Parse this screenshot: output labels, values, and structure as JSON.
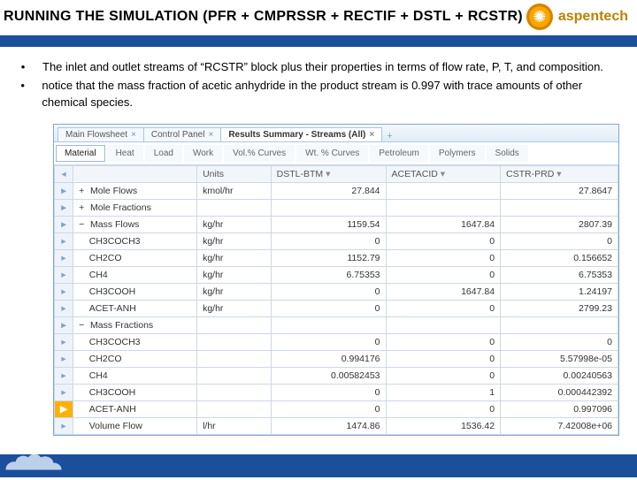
{
  "header": {
    "title": "RUNNING THE SIMULATION (PFR + CMPRSSR + RECTIF + DSTL + RCSTR)",
    "brand": "aspentech"
  },
  "bullets": [
    "The inlet and outlet streams of “RCSTR” block plus their properties in terms of flow rate, P, T, and composition.",
    "notice that the mass fraction of acetic anhydride in the product stream is 0.997 with trace amounts of other chemical species."
  ],
  "window": {
    "tabs": [
      "Main Flowsheet",
      "Control Panel",
      "Results Summary - Streams (All)"
    ],
    "activeTab": 2,
    "subTabs": [
      "Material",
      "Heat",
      "Load",
      "Work",
      "Vol.% Curves",
      "Wt. % Curves",
      "Petroleum",
      "Polymers",
      "Solids"
    ]
  },
  "grid": {
    "unitsHeader": "Units",
    "streams": [
      "DSTL-BTM",
      "ACETACID",
      "CSTR-PRD"
    ],
    "rows": [
      {
        "section": true,
        "exp": "+",
        "label": "Mole Flows",
        "units": "kmol/hr",
        "v": [
          "27.844",
          "",
          "27.8647"
        ]
      },
      {
        "section": true,
        "exp": "+",
        "label": "Mole Fractions",
        "units": "",
        "v": [
          "",
          "",
          ""
        ]
      },
      {
        "section": true,
        "exp": "−",
        "label": "Mass Flows",
        "units": "kg/hr",
        "v": [
          "1159.54",
          "1647.84",
          "2807.39"
        ]
      },
      {
        "label": "CH3COCH3",
        "units": "kg/hr",
        "v": [
          "0",
          "0",
          "0"
        ]
      },
      {
        "label": "CH2CO",
        "units": "kg/hr",
        "v": [
          "1152.79",
          "0",
          "0.156652"
        ]
      },
      {
        "label": "CH4",
        "units": "kg/hr",
        "v": [
          "6.75353",
          "0",
          "6.75353"
        ]
      },
      {
        "label": "CH3COOH",
        "units": "kg/hr",
        "v": [
          "0",
          "1647.84",
          "1.24197"
        ]
      },
      {
        "label": "ACET-ANH",
        "units": "kg/hr",
        "v": [
          "0",
          "0",
          "2799.23"
        ]
      },
      {
        "section": true,
        "exp": "−",
        "label": "Mass Fractions",
        "units": "",
        "v": [
          "",
          "",
          ""
        ]
      },
      {
        "label": "CH3COCH3",
        "units": "",
        "v": [
          "0",
          "0",
          "0"
        ]
      },
      {
        "label": "CH2CO",
        "units": "",
        "v": [
          "0.994176",
          "0",
          "5.57998e-05"
        ]
      },
      {
        "label": "CH4",
        "units": "",
        "v": [
          "0.00582453",
          "0",
          "0.00240563"
        ]
      },
      {
        "label": "CH3COOH",
        "units": "",
        "v": [
          "0",
          "1",
          "0.000442392"
        ]
      },
      {
        "current": true,
        "label": "ACET-ANH",
        "units": "",
        "v": [
          "0",
          "0",
          "0.997096"
        ]
      },
      {
        "label": "Volume Flow",
        "units": "l/hr",
        "v": [
          "1474.86",
          "1536.42",
          "7.42008e+06"
        ]
      }
    ]
  }
}
